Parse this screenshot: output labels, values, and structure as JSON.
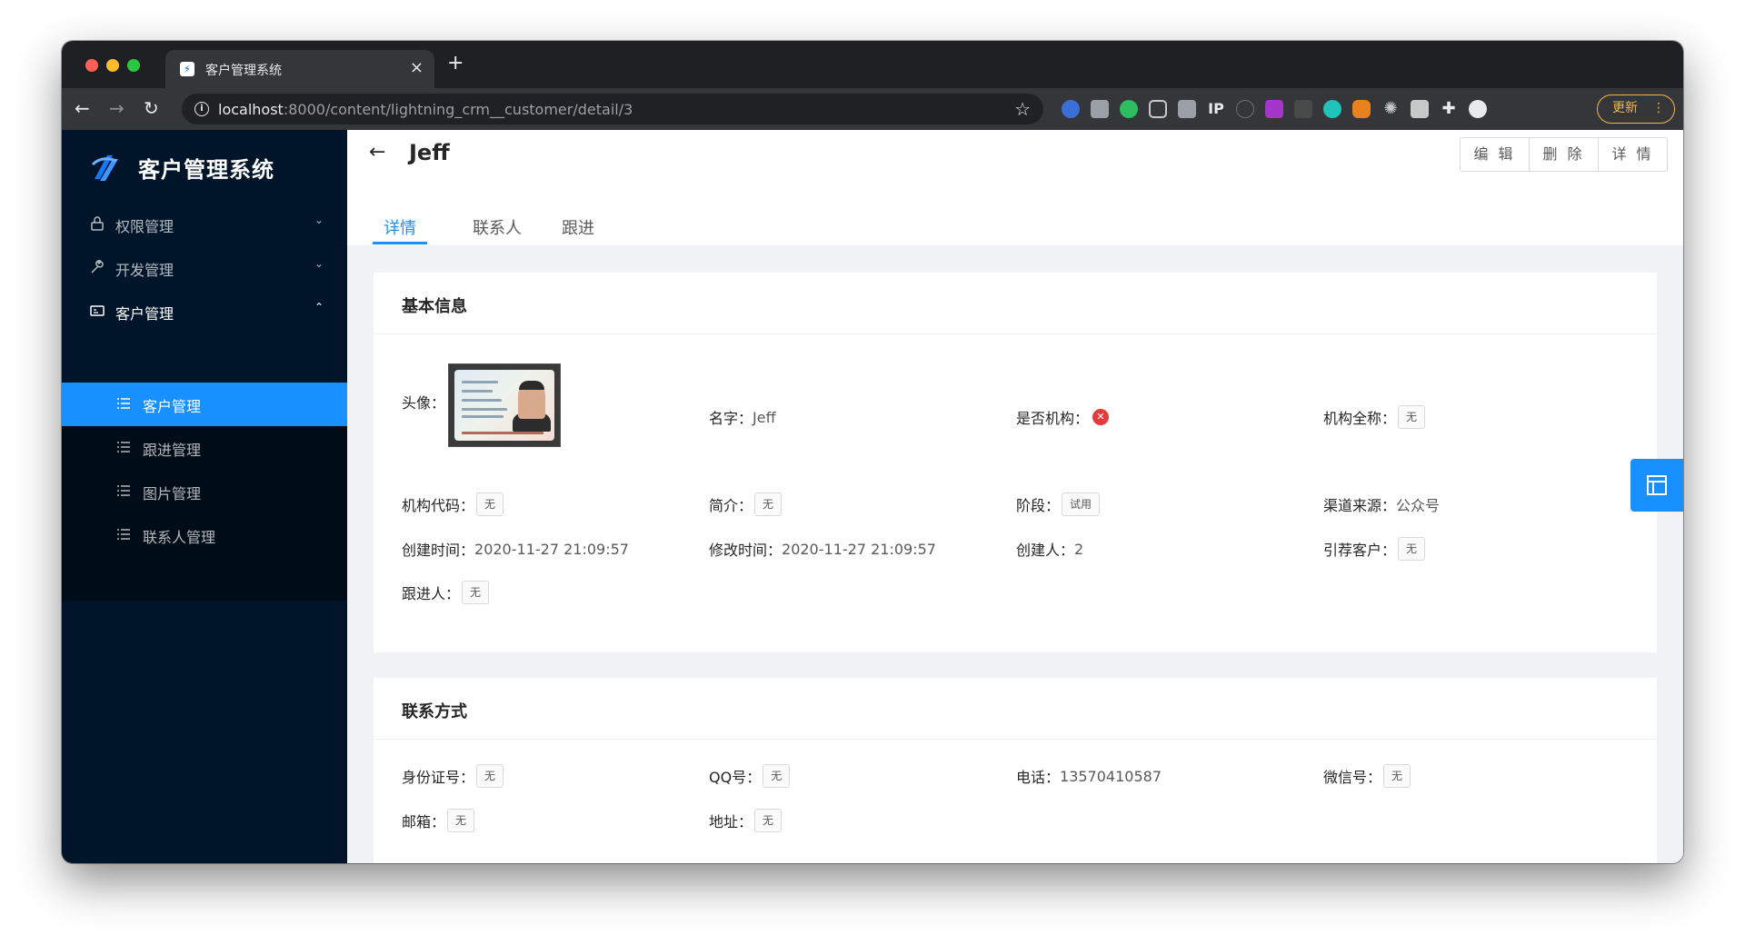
{
  "browser": {
    "tab_title": "客户管理系统",
    "url_host": "localhost",
    "url_rest": ":8000/content/lightning_crm__customer/detail/3",
    "update_label": "更新"
  },
  "sidebar": {
    "app_title": "客户管理系统",
    "menus": [
      {
        "label": "权限管理"
      },
      {
        "label": "开发管理"
      },
      {
        "label": "客户管理"
      }
    ],
    "submenus": [
      {
        "label": "客户管理"
      },
      {
        "label": "跟进管理"
      },
      {
        "label": "图片管理"
      },
      {
        "label": "联系人管理"
      }
    ]
  },
  "header": {
    "title": "Jeff",
    "buttons": {
      "edit": "编 辑",
      "delete": "删 除",
      "detail": "详 情"
    },
    "tabs": [
      {
        "label": "详情"
      },
      {
        "label": "联系人"
      },
      {
        "label": "跟进"
      }
    ]
  },
  "basic": {
    "title": "基本信息",
    "avatar_label": "头像：",
    "name_label": "名字：",
    "name_value": "Jeff",
    "is_org_label": "是否机构：",
    "org_fullname_label": "机构全称：",
    "org_fullname_value": "无",
    "org_code_label": "机构代码：",
    "org_code_value": "无",
    "intro_label": "简介：",
    "intro_value": "无",
    "stage_label": "阶段：",
    "stage_value": "试用",
    "channel_label": "渠道来源：",
    "channel_value": "公众号",
    "created_label": "创建时间：",
    "created_value": "2020-11-27 21:09:57",
    "modified_label": "修改时间：",
    "modified_value": "2020-11-27 21:09:57",
    "creator_label": "创建人：",
    "creator_value": "2",
    "referrer_label": "引荐客户：",
    "referrer_value": "无",
    "follower_label": "跟进人：",
    "follower_value": "无"
  },
  "contact": {
    "title": "联系方式",
    "idcard_label": "身份证号：",
    "idcard_value": "无",
    "qq_label": "QQ号：",
    "qq_value": "无",
    "phone_label": "电话：",
    "phone_value": "13570410587",
    "wechat_label": "微信号：",
    "wechat_value": "无",
    "email_label": "邮箱：",
    "email_value": "无",
    "address_label": "地址：",
    "address_value": "无"
  },
  "colors": {
    "primary": "#1890ff",
    "sidebar": "#001529",
    "submenu": "#000c17",
    "error": "#e23b3b"
  }
}
